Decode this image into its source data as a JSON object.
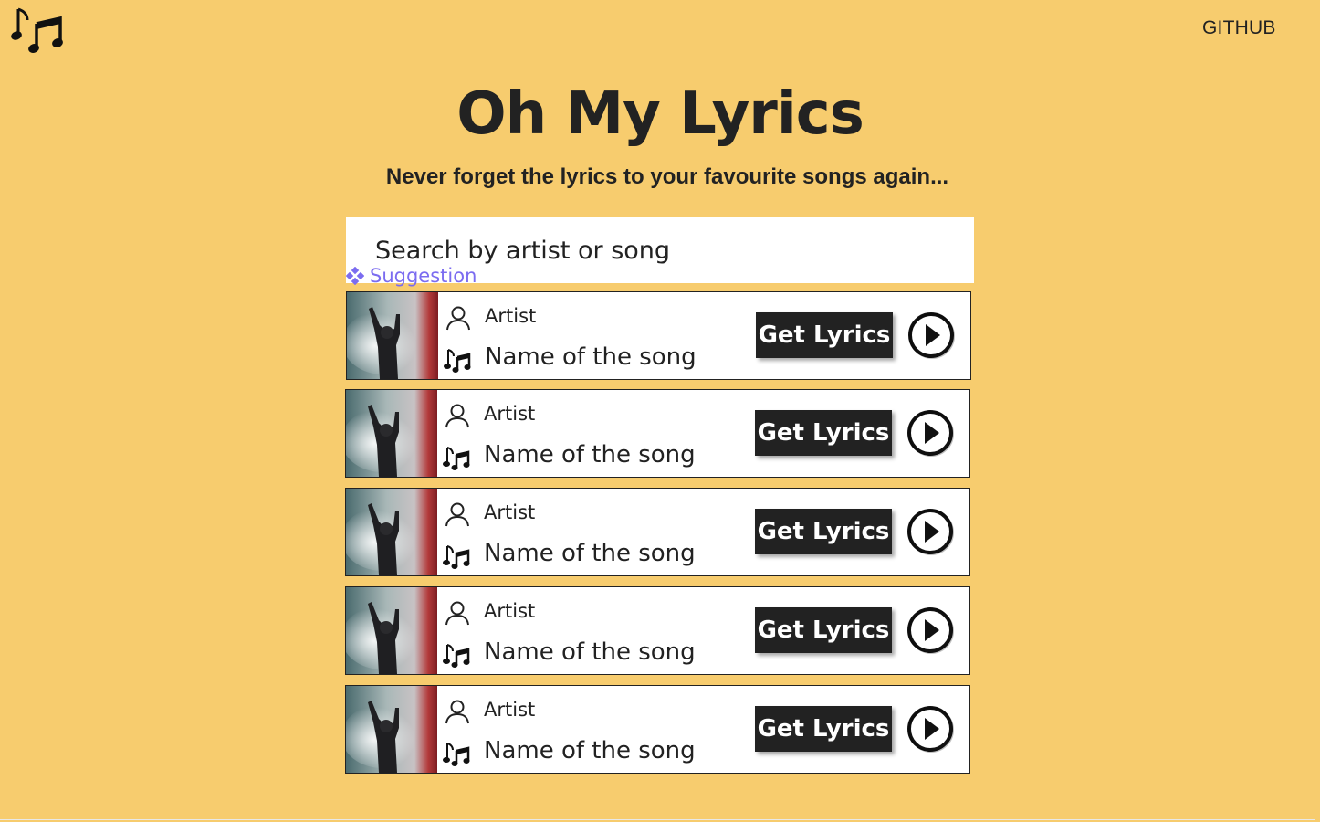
{
  "header": {
    "logo_icon": "music-notes-icon",
    "github_label": "GITHUB"
  },
  "hero": {
    "title": "Oh My Lyrics",
    "subtitle": "Never forget the lyrics to your favourite songs again..."
  },
  "search": {
    "placeholder": "Search by artist or song",
    "suggestion_label": "Suggestion"
  },
  "colors": {
    "background": "#f7cc6e",
    "button": "#222222",
    "suggestion": "#7b6cf0"
  },
  "results": [
    {
      "artist": "Artist",
      "song": "Name of the song",
      "button_label": "Get Lyrics"
    },
    {
      "artist": "Artist",
      "song": "Name of the song",
      "button_label": "Get Lyrics"
    },
    {
      "artist": "Artist",
      "song": "Name of the song",
      "button_label": "Get Lyrics"
    },
    {
      "artist": "Artist",
      "song": "Name of the song",
      "button_label": "Get Lyrics"
    },
    {
      "artist": "Artist",
      "song": "Name of the song",
      "button_label": "Get Lyrics"
    }
  ]
}
